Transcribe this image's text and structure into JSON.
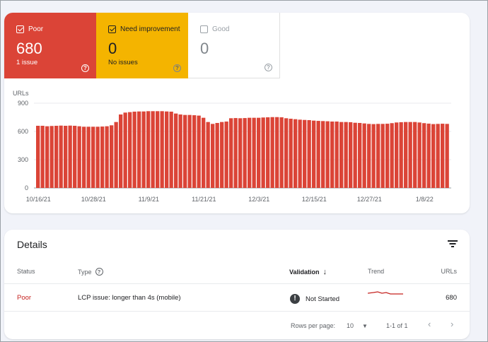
{
  "summary": {
    "poor": {
      "label": "Poor",
      "count": "680",
      "sub": "1 issue",
      "checked": true
    },
    "need_improvement": {
      "label": "Need improvement",
      "count": "0",
      "sub": "No issues",
      "checked": true
    },
    "good": {
      "label": "Good",
      "count": "0",
      "checked": false
    },
    "help_glyph": "?"
  },
  "chart_data": {
    "type": "bar",
    "ylabel": "URLs",
    "ylim": [
      0,
      900
    ],
    "yticks": [
      0,
      300,
      600,
      900
    ],
    "xtick_labels": [
      "10/16/21",
      "10/28/21",
      "11/9/21",
      "11/21/21",
      "12/3/21",
      "12/15/21",
      "12/27/21",
      "1/8/22"
    ],
    "color": "#db4437",
    "values": [
      660,
      660,
      655,
      658,
      660,
      662,
      660,
      662,
      660,
      655,
      650,
      650,
      650,
      650,
      652,
      655,
      665,
      700,
      780,
      800,
      805,
      810,
      812,
      812,
      815,
      815,
      815,
      815,
      812,
      810,
      790,
      780,
      775,
      775,
      772,
      768,
      745,
      700,
      680,
      690,
      700,
      705,
      740,
      742,
      740,
      742,
      745,
      745,
      745,
      748,
      750,
      752,
      752,
      750,
      740,
      735,
      730,
      725,
      722,
      720,
      715,
      712,
      710,
      708,
      705,
      705,
      700,
      700,
      698,
      692,
      690,
      685,
      680,
      678,
      680,
      680,
      682,
      688,
      695,
      698,
      700,
      700,
      700,
      695,
      688,
      683,
      678,
      680,
      682,
      680
    ]
  },
  "details": {
    "title": "Details",
    "columns": {
      "status": "Status",
      "type": "Type",
      "validation": "Validation",
      "trend": "Trend",
      "urls": "URLs"
    },
    "row": {
      "status": "Poor",
      "type": "LCP issue: longer than 4s (mobile)",
      "validation": "Not Started",
      "urls": "680"
    },
    "footer": {
      "rows_per_page_label": "Rows per page:",
      "rows_per_page": "10",
      "range": "1-1 of 1"
    }
  }
}
